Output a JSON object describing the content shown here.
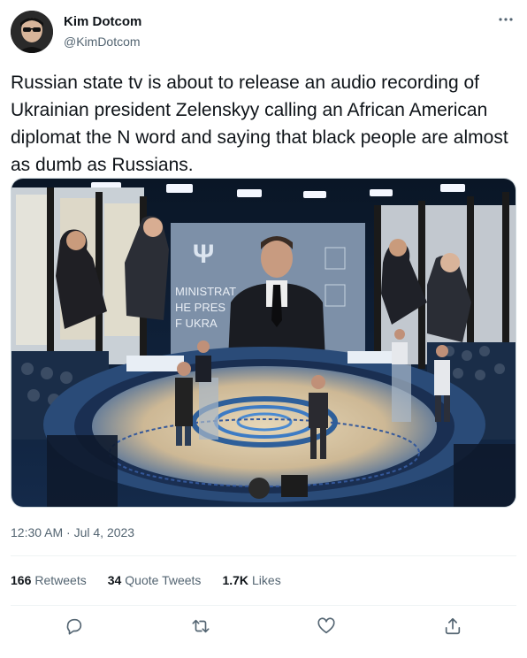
{
  "author": {
    "name": "Kim Dotcom",
    "handle": "@KimDotcom"
  },
  "menu_icon": "more-horizontal-icon",
  "tweet": {
    "text": "Russian state tv is about to release an audio recording of Ukrainian president Zelenskyy calling an African American diplomat the N word and saying that black people are almost as dumb as Russians."
  },
  "media": {
    "backdrop_text": "MINISTRAT\nHE PRES\nF UKRA"
  },
  "meta": {
    "timestamp": "12:30 AM · Jul 4, 2023"
  },
  "stats": [
    {
      "count": "166",
      "label": "Retweets"
    },
    {
      "count": "34",
      "label": "Quote Tweets"
    },
    {
      "count": "1.7K",
      "label": "Likes"
    }
  ],
  "actions": [
    "reply-icon",
    "retweet-icon",
    "like-icon",
    "share-icon"
  ],
  "colors": {
    "text": "#0f1419",
    "secondary": "#536471",
    "divider": "#eff3f4"
  }
}
